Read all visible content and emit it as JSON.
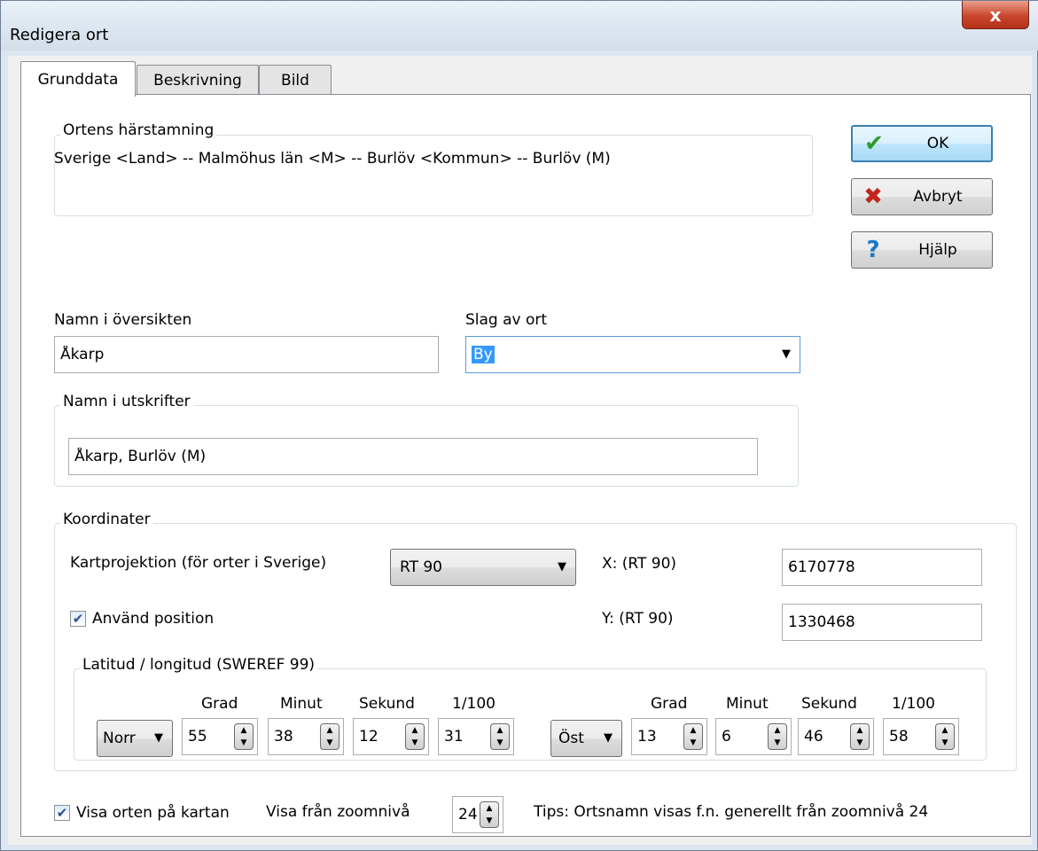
{
  "window": {
    "title": "Redigera ort",
    "close_label": "x"
  },
  "tabs": [
    {
      "label": "Grunddata",
      "active": true
    },
    {
      "label": "Beskrivning",
      "active": false
    },
    {
      "label": "Bild",
      "active": false
    }
  ],
  "origin": {
    "legend": "Ortens härstamning",
    "text": "Sverige <Land> -- Malmöhus län <M> -- Burlöv <Kommun> -- Burlöv (M)"
  },
  "buttons": {
    "ok": "OK",
    "cancel": "Avbryt",
    "help": "Hjälp"
  },
  "overview": {
    "label": "Namn i översikten",
    "value": "Åkarp"
  },
  "place_type": {
    "label": "Slag av ort",
    "value": "By"
  },
  "print_name": {
    "legend": "Namn i utskrifter",
    "value": "Åkarp, Burlöv (M)"
  },
  "coords": {
    "legend": "Koordinater",
    "projection_label": "Kartprojektion (för orter i Sverige)",
    "projection_value": "RT 90",
    "use_position_label": "Använd position",
    "use_position_checked": true,
    "x_label": "X:  (RT 90)",
    "x_value": "6170778",
    "y_label": "Y:  (RT 90)",
    "y_value": "1330468",
    "latlon": {
      "legend": "Latitud / longitud (SWEREF 99)",
      "headers": [
        "Grad",
        "Minut",
        "Sekund",
        "1/100"
      ],
      "lat_dir": "Norr",
      "lat": [
        "55",
        "38",
        "12",
        "31"
      ],
      "lon_dir": "Öst",
      "lon": [
        "13",
        "6",
        "46",
        "58"
      ]
    }
  },
  "footer": {
    "show_on_map_label": "Visa orten på kartan",
    "show_on_map_checked": true,
    "zoom_label": "Visa från zoomnivå",
    "zoom_value": "24",
    "tip": "Tips: Ortsnamn visas f.n. generellt från zoomnivå 24"
  }
}
